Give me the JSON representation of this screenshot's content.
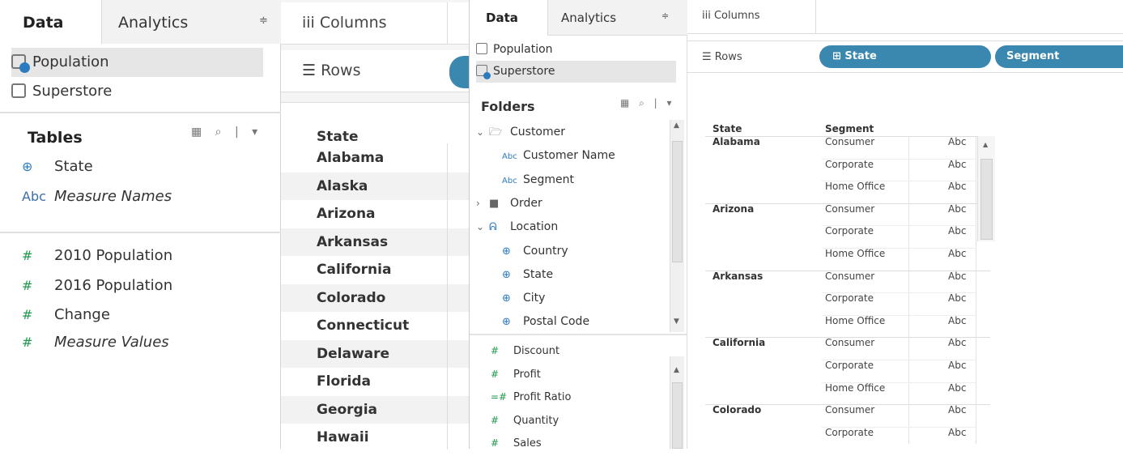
{
  "left_pane": {
    "tab_data": "Data",
    "tab_analytics": "Analytics",
    "tab_arrow": "≑",
    "datasources": [
      "Population",
      "Superstore"
    ],
    "tables_heading": "Tables",
    "tools": "▦ ⌕ | ▾",
    "dimensions": [
      {
        "icon": "⊕",
        "label": "State"
      },
      {
        "icon": "Abc",
        "label": "Measure Names"
      }
    ],
    "measures": [
      {
        "icon": "#",
        "label": "2010 Population"
      },
      {
        "icon": "#",
        "label": "2016 Population"
      },
      {
        "icon": "#",
        "label": "Change"
      },
      {
        "icon": "#",
        "label": "Measure Values"
      }
    ]
  },
  "mid_view": {
    "columns_label": "iii  Columns",
    "rows_label": "☰  Rows",
    "header": "State",
    "states": [
      "Alabama",
      "Alaska",
      "Arizona",
      "Arkansas",
      "California",
      "Colorado",
      "Connecticut",
      "Delaware",
      "Florida",
      "Georgia",
      "Hawaii"
    ]
  },
  "data_pane": {
    "tab_data": "Data",
    "tab_analytics": "Analytics",
    "tab_arrow": "≑",
    "datasources": [
      "Population",
      "Superstore"
    ],
    "folders_heading": "Folders",
    "tools": "▦ ⌕ | ▾",
    "tree": [
      {
        "prefix": "⌄",
        "icon": "🗁",
        "label": "Customer"
      },
      {
        "prefix": "",
        "icon": "Abc",
        "label": "Customer Name"
      },
      {
        "prefix": "",
        "icon": "Abc",
        "label": "Segment"
      },
      {
        "prefix": "›",
        "icon": "■",
        "label": "Order"
      },
      {
        "prefix": "⌄",
        "icon": "ᕱ",
        "label": "Location"
      },
      {
        "prefix": "",
        "icon": "⊕",
        "label": "Country"
      },
      {
        "prefix": "",
        "icon": "⊕",
        "label": "State"
      },
      {
        "prefix": "",
        "icon": "⊕",
        "label": "City"
      },
      {
        "prefix": "",
        "icon": "⊕",
        "label": "Postal Code"
      }
    ],
    "measures": [
      {
        "icon": "#",
        "label": "Discount"
      },
      {
        "icon": "#",
        "label": "Profit"
      },
      {
        "icon": "=#",
        "label": "Profit Ratio"
      },
      {
        "icon": "#",
        "label": "Quantity"
      },
      {
        "icon": "#",
        "label": "Sales"
      }
    ]
  },
  "right_view": {
    "columns_label": "iii  Columns",
    "rows_label": "☰  Rows",
    "pill_state": "⊞ State",
    "pill_segment": "Segment",
    "header_state": "State",
    "header_segment": "Segment",
    "groups": [
      {
        "state": "Alabama",
        "segments": [
          "Consumer",
          "Corporate",
          "Home Office"
        ]
      },
      {
        "state": "Arizona",
        "segments": [
          "Consumer",
          "Corporate",
          "Home Office"
        ]
      },
      {
        "state": "Arkansas",
        "segments": [
          "Consumer",
          "Corporate",
          "Home Office"
        ]
      },
      {
        "state": "California",
        "segments": [
          "Consumer",
          "Corporate",
          "Home Office"
        ]
      },
      {
        "state": "Colorado",
        "segments": [
          "Consumer",
          "Corporate"
        ]
      }
    ],
    "abc": "Abc"
  }
}
